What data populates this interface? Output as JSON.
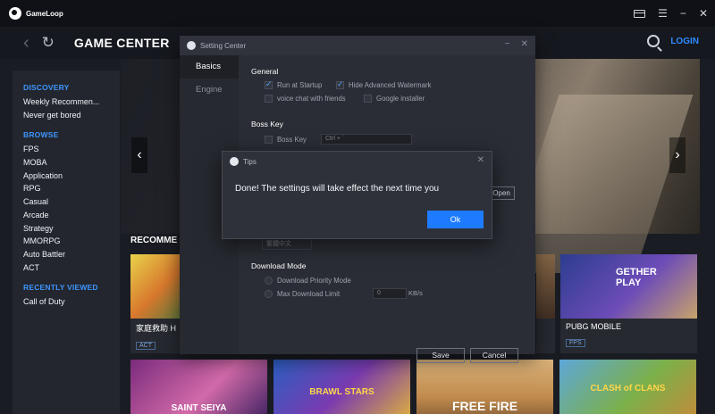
{
  "app": {
    "name": "GameLoop"
  },
  "window_controls": {
    "card_icon": "card-icon",
    "menu_glyph": "☰",
    "minimize_glyph": "−",
    "close_glyph": "✕"
  },
  "nav": {
    "back_glyph": "‹",
    "refresh_glyph": "↻",
    "title": "GAME CENTER",
    "login_label": "LOGIN",
    "accent": "#2e8bff"
  },
  "sidebar": {
    "discovery_heading": "DISCOVERY",
    "discovery_items": [
      "Weekly Recommen...",
      "Never get bored"
    ],
    "browse_heading": "BROWSE",
    "browse_items": [
      "FPS",
      "MOBA",
      "Application",
      "RPG",
      "Casual",
      "Arcade",
      "Strategy",
      "MMORPG",
      "Auto Battler",
      "ACT"
    ],
    "recent_heading": "RECENTLY VIEWED",
    "recent_items": [
      "Call of Duty"
    ]
  },
  "hero": {
    "prev_glyph": "‹",
    "next_glyph": "›"
  },
  "recommend": {
    "heading": "RECOMME",
    "cards": [
      {
        "name": "家庭救助 H",
        "tag": "ACT"
      },
      {
        "name": "PUBG MOBILE",
        "tag": "FPS",
        "art_text": "GETHER PLAY"
      }
    ]
  },
  "tiles": [
    {
      "label": "SAINT SEIYA"
    },
    {
      "label": "BRAWL STARS"
    },
    {
      "label": "FREE FIRE"
    },
    {
      "label": "CLASH of CLANS"
    }
  ],
  "settings": {
    "title": "Setting Center",
    "tabs": [
      "Basics",
      "Engine"
    ],
    "general_heading": "General",
    "run_at_startup": "Run at Startup",
    "hide_watermark": "Hide Advanced Watermark",
    "voice_chat": "voice chat with friends",
    "google_installer": "Google installer",
    "boss_key_heading": "Boss Key",
    "boss_key_label": "Boss Key",
    "boss_key_value": "Ctrl + `",
    "open_label": "Open",
    "language_value": "繁體中文",
    "download_heading": "Download Mode",
    "priority_mode": "Download Priority Mode",
    "max_limit": "Max Download Limit",
    "limit_value": "0",
    "limit_unit": "KB/s",
    "save_label": "Save",
    "cancel_label": "Cancel",
    "minimize_glyph": "−",
    "close_glyph": "✕"
  },
  "tips": {
    "title": "Tips",
    "message": "Done! The settings will take effect the next time you",
    "ok_label": "Ok",
    "close_glyph": "✕"
  }
}
